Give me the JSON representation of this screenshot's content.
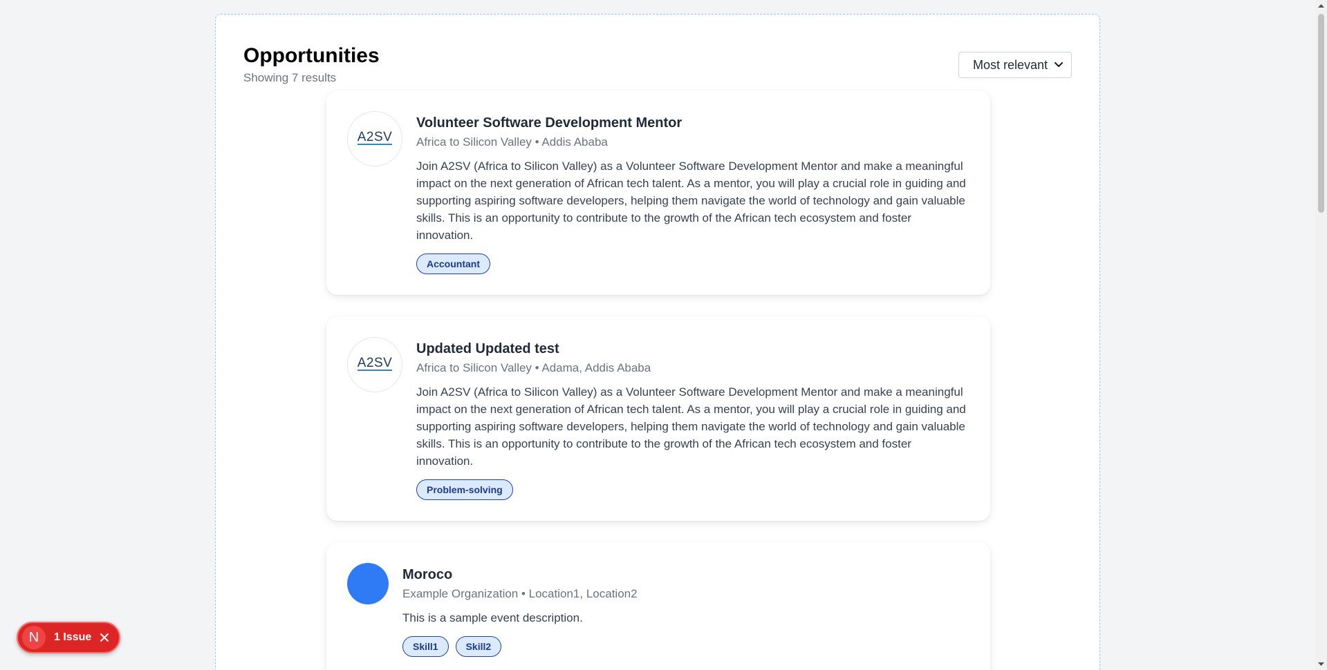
{
  "page": {
    "title": "Opportunities",
    "results_text": "Showing 7 results"
  },
  "sort": {
    "selected": "Most relevant"
  },
  "cards": [
    {
      "logo_text": "A2SV",
      "title": "Volunteer Software Development Mentor",
      "meta": "Africa to Silicon Valley • Addis Ababa",
      "description": "Join A2SV (Africa to Silicon Valley) as a Volunteer Software Development Mentor and make a meaningful impact on the next generation of African tech talent. As a mentor, you will play a crucial role in guiding and supporting aspiring software developers, helping them navigate the world of technology and gain valuable skills. This is an opportunity to contribute to the growth of the African tech ecosystem and foster innovation.",
      "tags": [
        "Accountant"
      ]
    },
    {
      "logo_text": "A2SV",
      "title": "Updated Updated test",
      "meta": "Africa to Silicon Valley • Adama, Addis Ababa",
      "description": "Join A2SV (Africa to Silicon Valley) as a Volunteer Software Development Mentor and make a meaningful impact on the next generation of African tech talent. As a mentor, you will play a crucial role in guiding and supporting aspiring software developers, helping them navigate the world of technology and gain valuable skills. This is an opportunity to contribute to the growth of the African tech ecosystem and foster innovation.",
      "tags": [
        "Problem-solving"
      ]
    },
    {
      "title": "Moroco",
      "meta": "Example Organization • Location1, Location2",
      "description": "This is a sample event description.",
      "tags": [
        "Skill1",
        "Skill2"
      ]
    }
  ],
  "issue_badge": {
    "avatar_letter": "N",
    "label": "1 Issue"
  },
  "colors": {
    "accent": "#2f7bf5",
    "tag_bg": "#dbeafe",
    "tag_border": "#1e40af",
    "issue_red": "#dc2626"
  }
}
